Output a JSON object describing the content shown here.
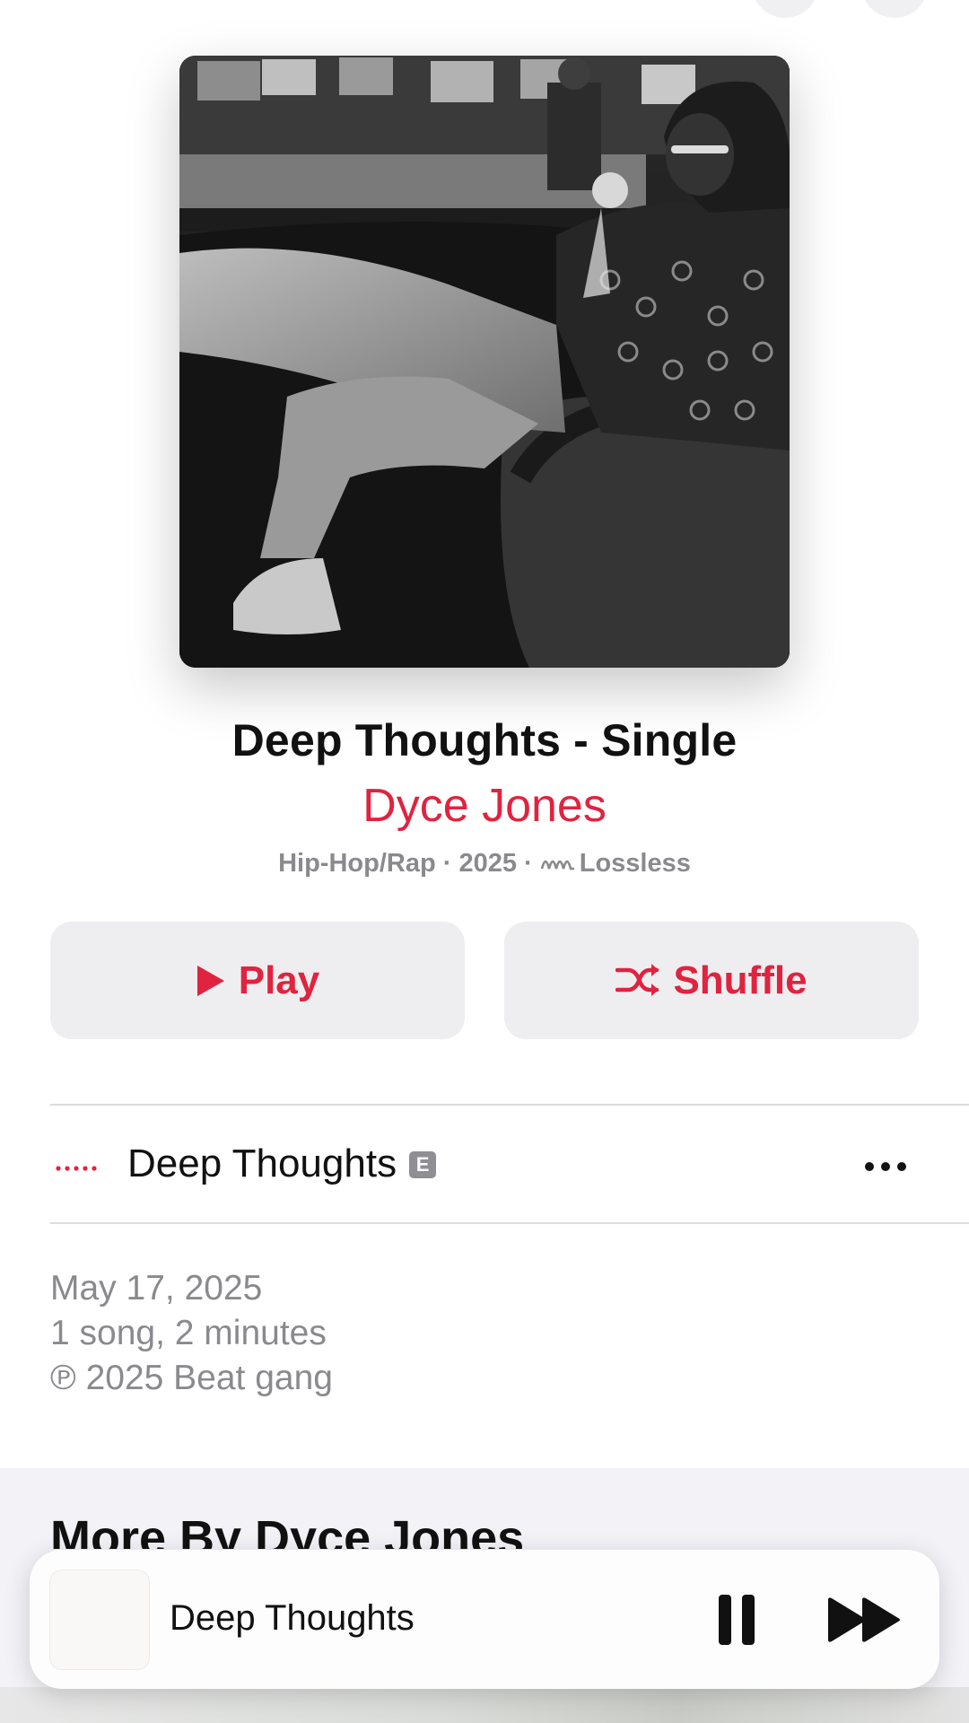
{
  "album": {
    "title": "Deep Thoughts - Single",
    "artist": "Dyce Jones",
    "meta": "Hip-Hop/Rap · 2025 · ",
    "quality": "Lossless"
  },
  "actions": {
    "play_label": "Play",
    "shuffle_label": "Shuffle"
  },
  "tracks": [
    {
      "title": "Deep Thoughts",
      "explicit_badge": "E",
      "playing": true
    }
  ],
  "info": {
    "release_date": "May 17, 2025",
    "summary": "1 song, 2 minutes",
    "copyright": "℗ 2025 Beat gang"
  },
  "more_section": {
    "heading": "More By Dyce Jones"
  },
  "mini_player": {
    "title": "Deep Thoughts",
    "state": "playing"
  },
  "icons": {
    "back": "chevron-left-icon",
    "play": "play-icon",
    "shuffle": "shuffle-icon",
    "lossless": "lossless-icon",
    "more": "ellipsis-icon",
    "pause": "pause-icon",
    "skip": "forward-icon"
  },
  "colors": {
    "accent": "#e0233f",
    "button_bg": "#eeeef0",
    "secondary_text": "#8a8a8e",
    "section_bg": "#f2f2f7"
  }
}
